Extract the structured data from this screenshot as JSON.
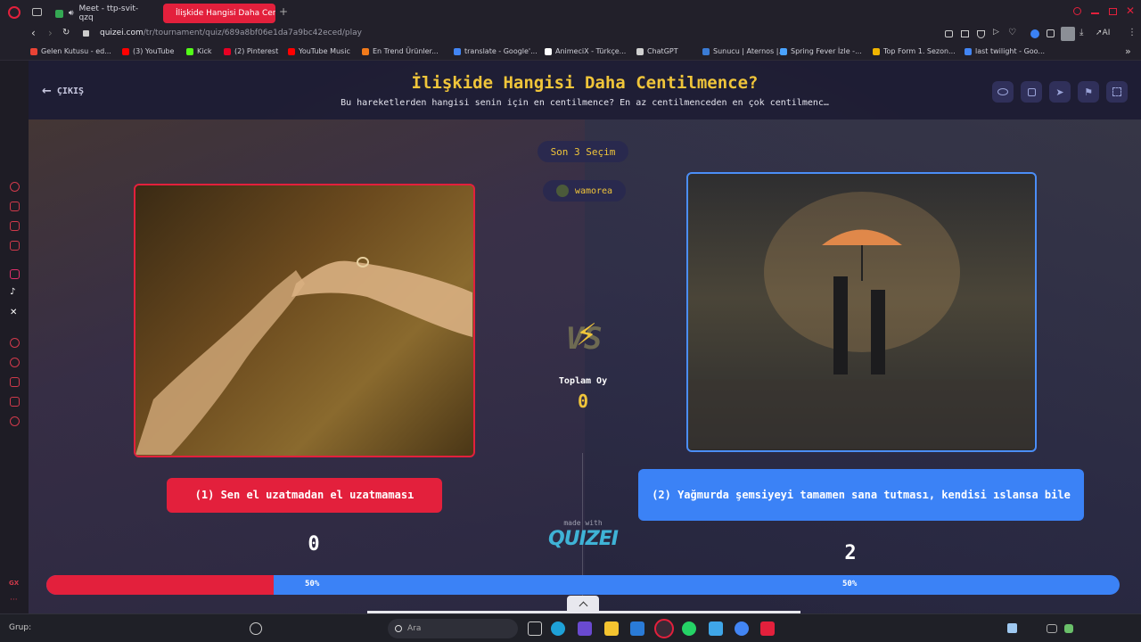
{
  "browser": {
    "tabs": [
      {
        "label": "Meet - ttp-svit-qzq"
      },
      {
        "label": "İlişkide Hangisi Daha Centi"
      }
    ],
    "url_host": "quizei.com",
    "url_path": "/tr/tournament/quiz/689a8bf06e1da7a9bc42eced/play",
    "toolbar_ai_label": "AI",
    "bookmarks": [
      {
        "label": "Gelen Kutusu - ed...",
        "color": "#ea4335"
      },
      {
        "label": "(3) YouTube",
        "color": "#ff0000"
      },
      {
        "label": "Kick",
        "color": "#53fc18"
      },
      {
        "label": "(2) Pinterest",
        "color": "#e60023"
      },
      {
        "label": "YouTube Music",
        "color": "#ff0000"
      },
      {
        "label": "En Trend Ürünler...",
        "color": "#f27a1a"
      },
      {
        "label": "translate - Google'...",
        "color": "#4285f4"
      },
      {
        "label": "AnimeciX - Türkçe...",
        "color": "#ffffff"
      },
      {
        "label": "ChatGPT",
        "color": "#d0d0d0"
      },
      {
        "label": "Sunucu | Aternos |...",
        "color": "#3a7bd5"
      },
      {
        "label": "Spring Fever İzle -...",
        "color": "#4aa3ff"
      },
      {
        "label": "Top Form 1. Sezon...",
        "color": "#f0b400"
      },
      {
        "label": "last twilight - Goo...",
        "color": "#4285f4"
      }
    ]
  },
  "header": {
    "back_label": "ÇIKIŞ",
    "title": "İlişkide Hangisi Daha Centilmence?",
    "subtitle": "Bu hareketlerden hangisi senin için en centilmence? En az centilmenceden en çok centilmenc…"
  },
  "center": {
    "recent_label": "Son 3 Seçim",
    "recent_user": "wamorea",
    "vs_label": "VS",
    "total_label": "Toplam Oy",
    "total_value": "0",
    "made_with": "made with",
    "brand": "QUIZEI"
  },
  "options": [
    {
      "label": "(1) Sen el uzatmadan el uzatmaması",
      "votes": "0",
      "percent_label": "50%",
      "color": "#e3203c",
      "share": 0.5
    },
    {
      "label": "(2) Yağmurda şemsiyeyi tamamen sana tutması, kendisi ıslansa bile",
      "votes": "2",
      "percent_label": "50%",
      "color": "#3b82f6",
      "share": 0.5
    }
  ],
  "taskbar": {
    "left_label": "Grup:",
    "search_placeholder": "Ara"
  },
  "colors": {
    "accent_yellow": "#f0c53a",
    "red": "#e3203c",
    "blue": "#3b82f6"
  }
}
